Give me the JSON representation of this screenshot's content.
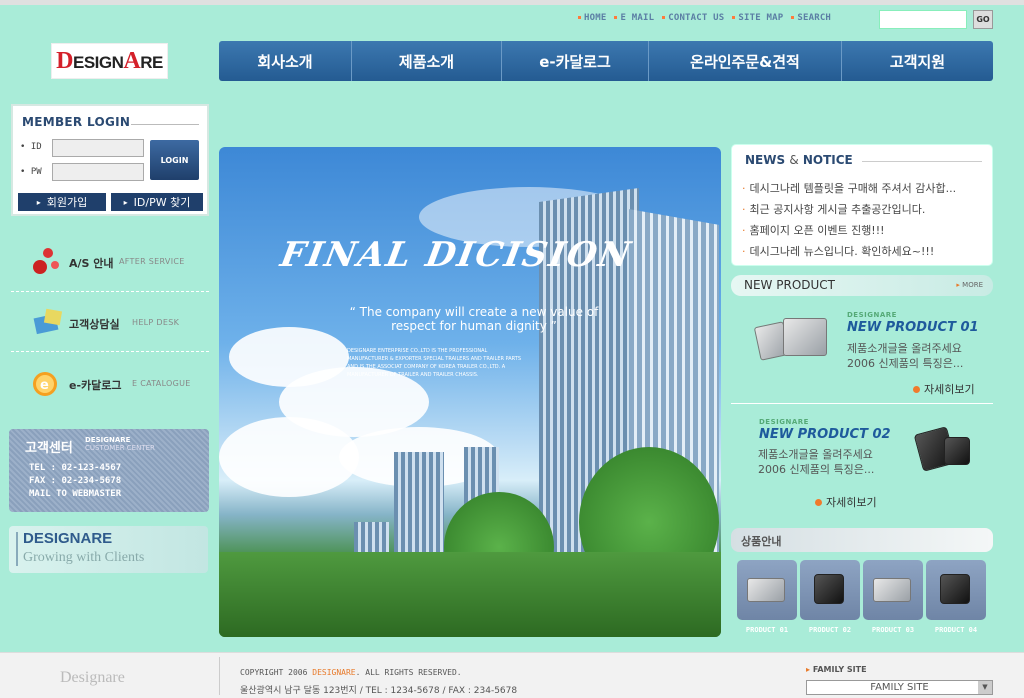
{
  "top_links": [
    "HOME",
    "E MAIL",
    "CONTACT US",
    "SITE MAP",
    "SEARCH"
  ],
  "search": {
    "placeholder": "",
    "button": "GO"
  },
  "logo": {
    "brand": "DESIGNARE"
  },
  "nav": [
    "회사소개",
    "제품소개",
    "e-카달로그",
    "온라인주문&견적",
    "고객지원"
  ],
  "login": {
    "title": "MEMBER LOGIN",
    "id_label": "ID",
    "pw_label": "PW",
    "login_button": "LOGIN",
    "join_button": "회원가입",
    "find_button": "ID/PW 찾기"
  },
  "left_menu": [
    {
      "ko": "A/S 안내",
      "en": "AFTER SERVICE"
    },
    {
      "ko": "고객상담실",
      "en": "HELP DESK"
    },
    {
      "ko": "e-카달로그",
      "en": "E CATALOGUE"
    }
  ],
  "customer_center": {
    "title": "고객센터",
    "brand": "DESIGNARE",
    "sub": "CUSTOMER CENTER",
    "tel": "TEL : 02-123-4567",
    "fax": "FAX : 02-234-5678",
    "mail": "MAIL TO WEBMASTER"
  },
  "designare_box": {
    "title": "DESIGNARE",
    "slogan": "Growing with Clients"
  },
  "banner": {
    "title": "FINAL DICISION",
    "quote_line1": "“ The company will create a new value of",
    "quote_line2": "respect for human dignity ”",
    "small_text": "DESIGNARE ENTERPRISE CO.,LTD IS THE PROFESSIONAL MANUFACTURER & EXPORTER SPECIAL TRAILERS AND TRAILER PARTS AND IS THE ASSOCIAT COMPANY OF KOREA TRAILER CO.,LTD. A MANUFACTURER OF TRAILER AND TRAILER CHASSIS."
  },
  "news": {
    "title": "NEWS",
    "title_and": "&",
    "title_rest": "NOTICE",
    "items": [
      "데시그나레 템플릿을 구매해 주셔서 감사합...",
      "최근 공지사항 게시글 추출공간입니다.",
      "홈페이지 오픈 이벤트 진행!!!",
      "데시그나레 뉴스입니다. 확인하세요~!!!"
    ]
  },
  "new_product": {
    "title": "NEW PRODUCT",
    "more": "MORE",
    "items": [
      {
        "brand": "DESIGNARE",
        "name": "NEW PRODUCT 01",
        "desc1": "제품소개글을 올려주세요",
        "desc2": "2006 신제품의 특징은...",
        "more": "자세히보기"
      },
      {
        "brand": "DESIGNARE",
        "name": "NEW PRODUCT 02",
        "desc1": "제품소개글을 올려주세요",
        "desc2": "2006 신제품의 특징은...",
        "more": "자세히보기"
      }
    ]
  },
  "products": {
    "title": "상품안내",
    "items": [
      "PRODUCT 01",
      "PRODUCT 02",
      "PRODUCT 03",
      "PRODUCT 04"
    ]
  },
  "footer": {
    "logo": "Designare",
    "copyright_pre": "COPYRIGHT 2006",
    "copyright_brand": "DESIGNARE",
    "copyright_post": ". ALL RIGHTS RESERVED.",
    "address": "울산광역시 남구 달동 123번지  /  TEL : 1234-5678  /  FAX : 234-5678",
    "family_label": "FAMILY SITE",
    "family_select": "FAMILY SITE"
  }
}
